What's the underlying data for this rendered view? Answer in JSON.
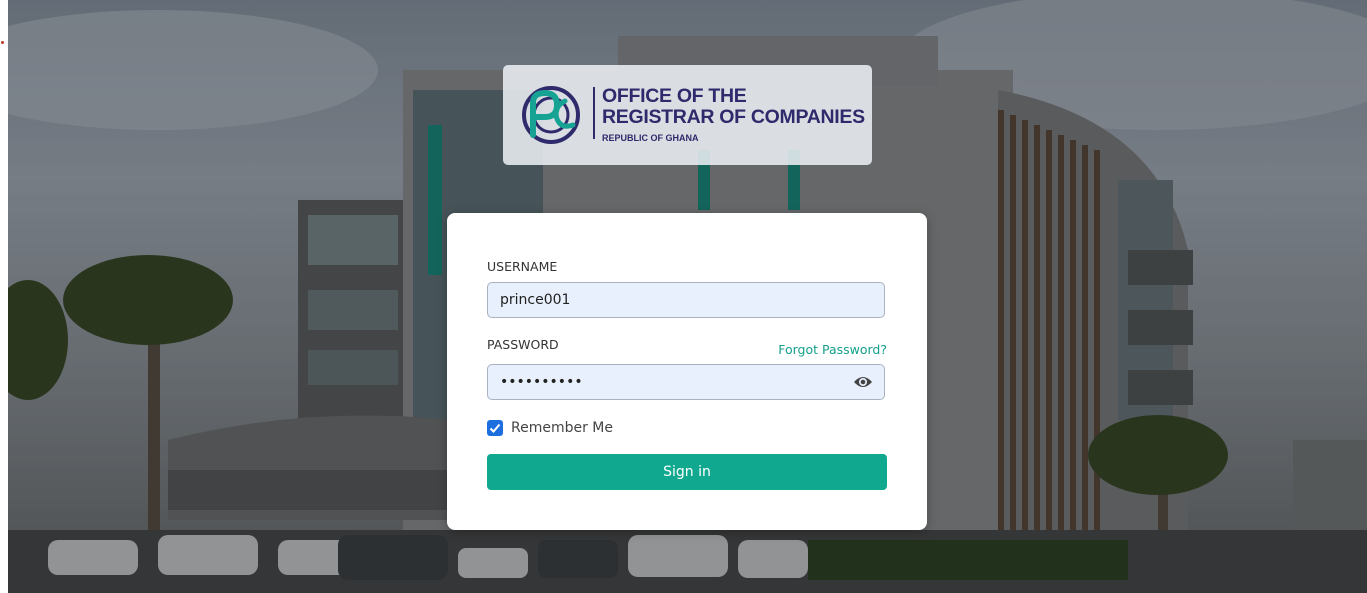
{
  "logo": {
    "line1": "OFFICE OF THE",
    "line2": "REGISTRAR OF COMPANIES",
    "line3": "REPUBLIC OF GHANA",
    "icon": "orc-emblem"
  },
  "form": {
    "username_label": "USERNAME",
    "username_value": "prince001",
    "password_label": "PASSWORD",
    "password_value": "••••••••••",
    "forgot_label": "Forgot Password?",
    "remember_label": "Remember Me",
    "remember_checked": true,
    "signin_label": "Sign in",
    "show_password_icon": "eye-icon"
  },
  "colors": {
    "accent": "#11a890",
    "brand": "#2e2a6b",
    "checkbox": "#1d6fe0"
  }
}
